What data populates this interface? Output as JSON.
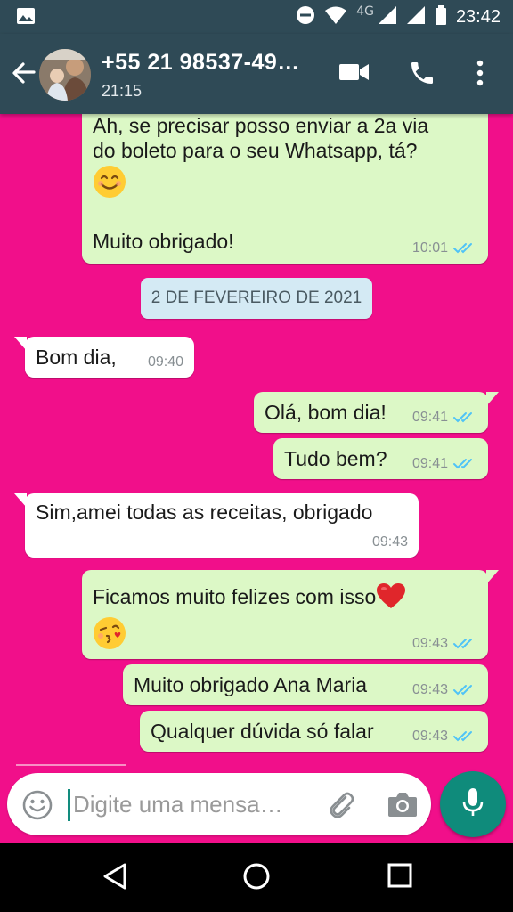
{
  "status_bar": {
    "network": "4G",
    "time": "23:42"
  },
  "header": {
    "contact_name": "+55 21 98537-49…",
    "last_seen": "21:15"
  },
  "messages": [
    {
      "direction": "outgoing",
      "lines": [
        "Ah, se precisar posso enviar a 2a via",
        "do boleto para o seu Whatsapp, tá?"
      ],
      "emoji": "smiling-face-icon",
      "line2": "Muito obrigado!",
      "time": "10:01",
      "status": "read"
    },
    {
      "direction": "incoming",
      "text": "Bom dia,",
      "time": "09:40"
    },
    {
      "direction": "outgoing",
      "text": "Olá, bom dia!",
      "time": "09:41",
      "status": "read"
    },
    {
      "direction": "outgoing",
      "text": "Tudo bem?",
      "time": "09:41",
      "status": "read"
    },
    {
      "direction": "incoming",
      "text": "Sim,amei todas as receitas, obrigado",
      "time": "09:43"
    },
    {
      "direction": "outgoing",
      "text": "Ficamos muito felizes com isso",
      "emoji": "kissing-face-icon",
      "time": "09:43",
      "status": "read"
    },
    {
      "direction": "outgoing",
      "text": "Muito obrigado Ana Maria",
      "time": "09:43",
      "status": "read"
    },
    {
      "direction": "outgoing",
      "text": "Qualquer dúvida só falar",
      "time": "09:43",
      "status": "read"
    }
  ],
  "date_chip": "2 DE FEVEREIRO DE 2021",
  "composer": {
    "placeholder": "Digite uma mensa…"
  },
  "colors": {
    "wallpaper": "#f10f8a",
    "header": "#2f4a56",
    "outgoing_bubble": "#dcf8c6",
    "incoming_bubble": "#ffffff",
    "read_ticks": "#4fc3f7",
    "mic_button": "#0f8b7b"
  }
}
